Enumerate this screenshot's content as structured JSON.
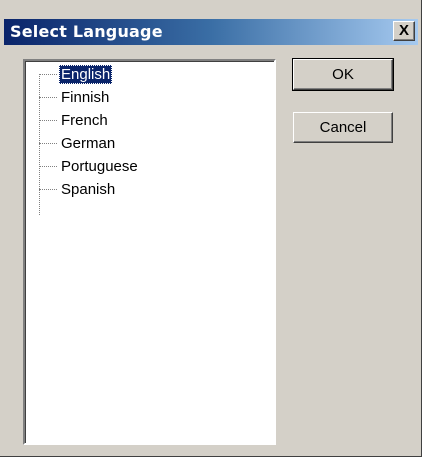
{
  "window": {
    "title": "Select Language",
    "close_label": "X"
  },
  "language_list": {
    "selected": "English",
    "items": [
      "English",
      "Finnish",
      "French",
      "German",
      "Portuguese",
      "Spanish"
    ]
  },
  "buttons": {
    "ok_label": "OK",
    "cancel_label": "Cancel"
  },
  "colors": {
    "selection": "#0a246a",
    "titlebar_start": "#0a246a",
    "titlebar_end": "#a6caf0",
    "face": "#d4d0c8"
  }
}
